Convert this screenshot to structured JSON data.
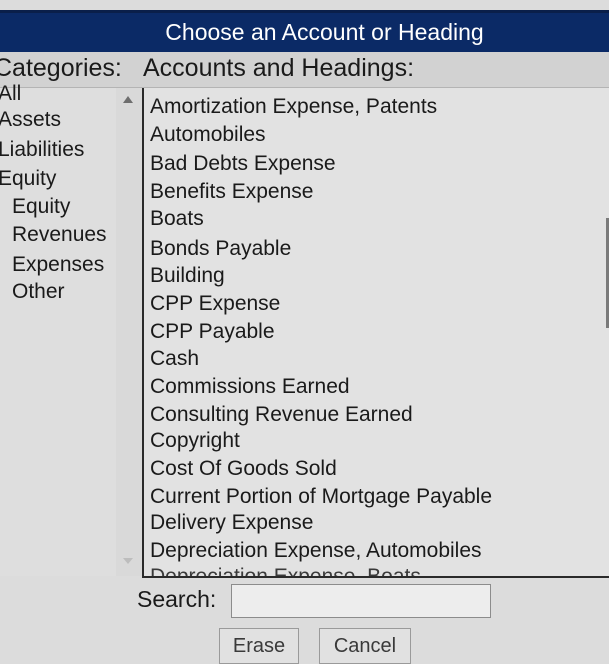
{
  "dialog": {
    "title": "Choose an Account or Heading"
  },
  "headers": {
    "categories": "Categories:",
    "accounts": "Accounts and Headings:"
  },
  "categories": [
    "All",
    "Assets",
    "Liabilities",
    "Equity",
    "Equity",
    "Revenues",
    "Expenses",
    "Other"
  ],
  "accounts": [
    "Amortization Expense, Patents",
    "Automobiles",
    "Bad Debts Expense",
    "Benefits Expense",
    "Boats",
    "Bonds Payable",
    "Building",
    "CPP Expense",
    "CPP Payable",
    "Cash",
    "Commissions Earned",
    "Consulting Revenue Earned",
    "Copyright",
    "Cost Of Goods Sold",
    "Current Portion of Mortgage Payable",
    "Delivery Expense",
    "Depreciation Expense, Automobiles",
    "Depreciation Expense, Boats"
  ],
  "search": {
    "label": "Search:",
    "value": "",
    "placeholder": ""
  },
  "buttons": {
    "erase": "Erase",
    "cancel": "Cancel"
  }
}
